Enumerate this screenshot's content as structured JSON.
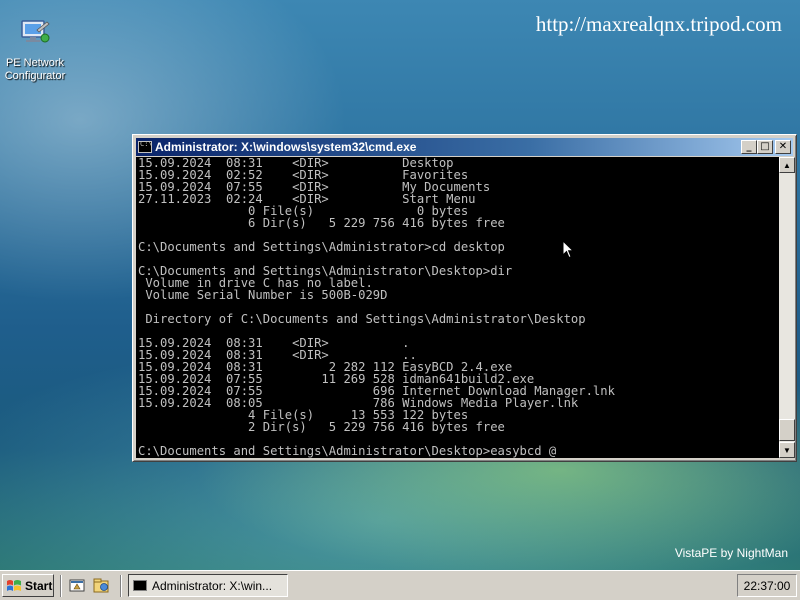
{
  "desktop": {
    "url_text": "http://maxrealqnx.tripod.com",
    "watermark": "VistaPE by NightMan",
    "icons": [
      {
        "label_line1": "PE Network",
        "label_line2": "Configurator",
        "icon": "network-configurator-icon"
      }
    ]
  },
  "cmd_window": {
    "title": "Administrator: X:\\windows\\system32\\cmd.exe",
    "buttons": {
      "minimize": "_",
      "maximize": "□",
      "close": "✕"
    },
    "lines": [
      "15.09.2024  08:31    <DIR>          Desktop",
      "15.09.2024  02:52    <DIR>          Favorites",
      "15.09.2024  07:55    <DIR>          My Documents",
      "27.11.2023  02:24    <DIR>          Start Menu",
      "               0 File(s)              0 bytes",
      "               6 Dir(s)   5 229 756 416 bytes free",
      "",
      "C:\\Documents and Settings\\Administrator>cd desktop",
      "",
      "C:\\Documents and Settings\\Administrator\\Desktop>dir",
      " Volume in drive C has no label.",
      " Volume Serial Number is 500B-029D",
      "",
      " Directory of C:\\Documents and Settings\\Administrator\\Desktop",
      "",
      "15.09.2024  08:31    <DIR>          .",
      "15.09.2024  08:31    <DIR>          ..",
      "15.09.2024  08:31         2 282 112 EasyBCD 2.4.exe",
      "15.09.2024  07:55        11 269 528 idman641build2.exe",
      "15.09.2024  07:55               696 Internet Download Manager.lnk",
      "15.09.2024  08:05               786 Windows Media Player.lnk",
      "               4 File(s)     13 553 122 bytes",
      "               2 Dir(s)   5 229 756 416 bytes free",
      "",
      "C:\\Documents and Settings\\Administrator\\Desktop>easybcd @"
    ]
  },
  "taskbar": {
    "start_label": "Start",
    "quick_launch": [
      "show-desktop-icon",
      "explorer-icon"
    ],
    "tasks": [
      {
        "label": "Administrator: X:\\win...",
        "icon": "cmd-icon"
      }
    ],
    "clock": "22:37:00"
  },
  "colors": {
    "console_bg": "#000000",
    "console_fg": "#c0c0c0",
    "titlebar_start": "#0a246a",
    "titlebar_end": "#a6caf0",
    "chrome": "#d4d0c8"
  }
}
